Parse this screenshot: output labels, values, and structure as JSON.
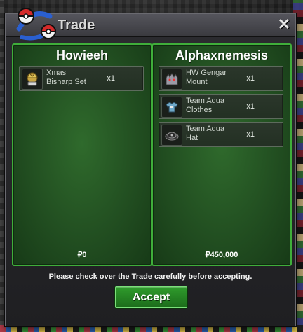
{
  "window": {
    "title": "Trade",
    "close_label": "✕"
  },
  "left": {
    "name": "Howieeh",
    "items": [
      {
        "name_line1": "Xmas",
        "name_line2": "Bisharp Set",
        "qty": "x1",
        "icon": "xmas-bisharp-set-icon"
      }
    ],
    "money": "₽0"
  },
  "right": {
    "name": "Alphaxnemesis",
    "items": [
      {
        "name_line1": "HW Gengar",
        "name_line2": "Mount",
        "qty": "x1",
        "icon": "gengar-mount-icon"
      },
      {
        "name_line1": "Team Aqua",
        "name_line2": "Clothes",
        "qty": "x1",
        "icon": "team-aqua-clothes-icon"
      },
      {
        "name_line1": "Team Aqua",
        "name_line2": "Hat",
        "qty": "x1",
        "icon": "team-aqua-hat-icon"
      }
    ],
    "money": "₽450,000"
  },
  "notice": "Please check over the Trade carefully before accepting.",
  "accept_label": "Accept",
  "colors": {
    "panel_border": "#3fae3a",
    "panel_fill": "#224f21",
    "accept": "#2f9b2c"
  }
}
